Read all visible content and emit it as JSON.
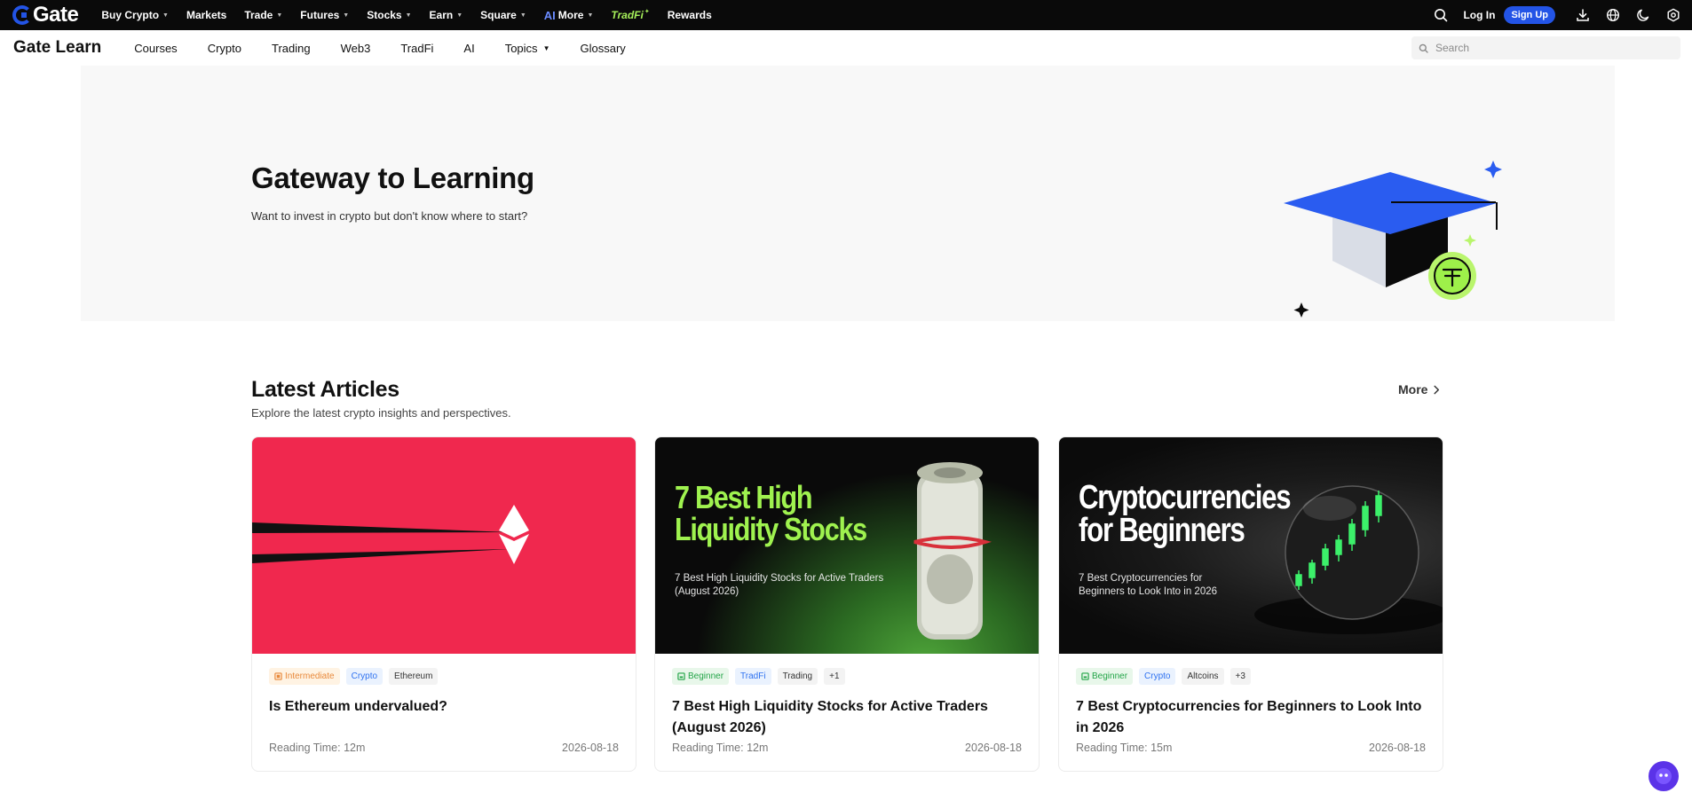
{
  "topbar": {
    "logo_text": "Gate",
    "nav": [
      {
        "label": "Buy Crypto",
        "caret": true
      },
      {
        "label": "Markets",
        "caret": false
      },
      {
        "label": "Trade",
        "caret": true
      },
      {
        "label": "Futures",
        "caret": true
      },
      {
        "label": "Stocks",
        "caret": true
      },
      {
        "label": "Earn",
        "caret": true
      },
      {
        "label": "Square",
        "caret": true
      }
    ],
    "ai_mark": "AI",
    "more_label": "More",
    "tradfi_label": "TradFi",
    "rewards_label": "Rewards",
    "login_label": "Log In",
    "signup_label": "Sign Up",
    "icons": [
      "search-icon",
      "download-icon",
      "globe-icon",
      "moon-icon",
      "settings-icon"
    ],
    "accent": "#2354e6"
  },
  "subnav": {
    "brand": "Gate Learn",
    "items": [
      "Courses",
      "Crypto",
      "Trading",
      "Web3",
      "TradFi",
      "AI"
    ],
    "topics_label": "Topics",
    "glossary_label": "Glossary",
    "search_placeholder": "Search"
  },
  "hero": {
    "title": "Gateway to Learning",
    "subtitle": "Want to invest in crypto but don't know where to start?"
  },
  "latest": {
    "title": "Latest Articles",
    "subtitle": "Explore the latest crypto insights and perspectives.",
    "more_label": "More",
    "cards": [
      {
        "tags": [
          {
            "label": "Intermediate",
            "kind": "level-intermediate"
          },
          {
            "label": "Crypto",
            "kind": "category"
          },
          {
            "label": "Ethereum",
            "kind": "topic"
          }
        ],
        "title": "Is Ethereum undervalued?",
        "reading_time": "Reading Time: 12m",
        "date": "2026-08-18",
        "image_bg": "#f0284e"
      },
      {
        "tags": [
          {
            "label": "Beginner",
            "kind": "level-beginner"
          },
          {
            "label": "TradFi",
            "kind": "category"
          },
          {
            "label": "Trading",
            "kind": "topic"
          },
          {
            "label": "+1",
            "kind": "topic"
          }
        ],
        "title": "7 Best High Liquidity Stocks for Active Traders (August 2026)",
        "reading_time": "Reading Time: 12m",
        "date": "2026-08-18",
        "image_headline": "7 Best High\nLiquidity Stocks",
        "image_subtext": "7 Best High Liquidity Stocks for Active Traders (August 2026)"
      },
      {
        "tags": [
          {
            "label": "Beginner",
            "kind": "level-beginner"
          },
          {
            "label": "Crypto",
            "kind": "category"
          },
          {
            "label": "Altcoins",
            "kind": "topic"
          },
          {
            "label": "+3",
            "kind": "topic"
          }
        ],
        "title": "7 Best Cryptocurrencies for Beginners to Look Into in 2026",
        "reading_time": "Reading Time: 15m",
        "date": "2026-08-18",
        "image_headline": "Cryptocurrencies\nfor Beginners",
        "image_subtext": "7 Best Cryptocurrencies for Beginners to Look Into in 2026"
      }
    ]
  }
}
